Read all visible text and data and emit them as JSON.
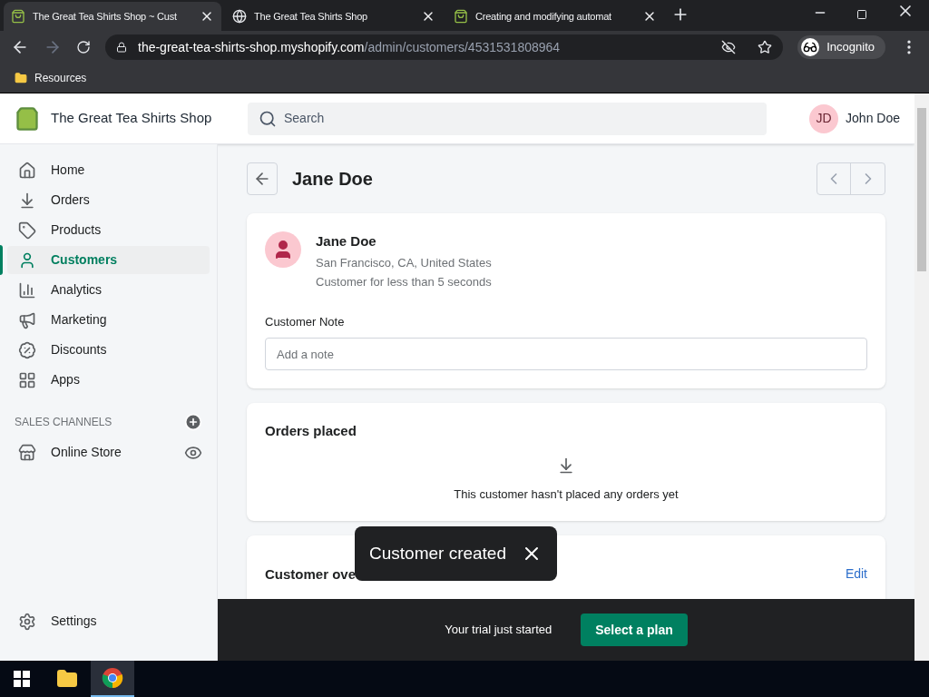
{
  "browser": {
    "tabs": [
      {
        "title": "The Great Tea Shirts Shop ~ Cust",
        "kind": "shop",
        "selected": true
      },
      {
        "title": "The Great Tea Shirts Shop",
        "kind": "globe",
        "selected": false
      },
      {
        "title": "Creating and modifying automat",
        "kind": "shop",
        "selected": false
      }
    ],
    "url_host": "the-great-tea-shirts-shop.myshopify.com",
    "url_path": "/admin/customers/4531531808964",
    "profile": "Incognito",
    "bookmarks": [
      "Resources"
    ]
  },
  "topbar": {
    "store_name": "The Great Tea Shirts Shop",
    "search_placeholder": "Search",
    "user_initials": "JD",
    "user_name": "John Doe"
  },
  "sidebar": {
    "items": [
      {
        "label": "Home",
        "selected": false
      },
      {
        "label": "Orders",
        "selected": false
      },
      {
        "label": "Products",
        "selected": false
      },
      {
        "label": "Customers",
        "selected": true
      },
      {
        "label": "Analytics",
        "selected": false
      },
      {
        "label": "Marketing",
        "selected": false
      },
      {
        "label": "Discounts",
        "selected": false
      },
      {
        "label": "Apps",
        "selected": false
      }
    ],
    "section_title": "SALES CHANNELS",
    "channels": [
      {
        "label": "Online Store"
      }
    ],
    "settings": "Settings"
  },
  "page": {
    "title": "Jane Doe",
    "customer": {
      "name": "Jane Doe",
      "location": "San Francisco, CA, United States",
      "since": "Customer for less than 5 seconds",
      "note_label": "Customer Note",
      "note_placeholder": "Add a note"
    },
    "orders": {
      "title": "Orders placed",
      "empty_text": "This customer hasn't placed any orders yet"
    },
    "overview": {
      "title": "Customer ove",
      "action": "Edit"
    }
  },
  "toast": {
    "text": "Customer created"
  },
  "trial_bar": {
    "text": "Your trial just started",
    "button": "Select a plan"
  }
}
